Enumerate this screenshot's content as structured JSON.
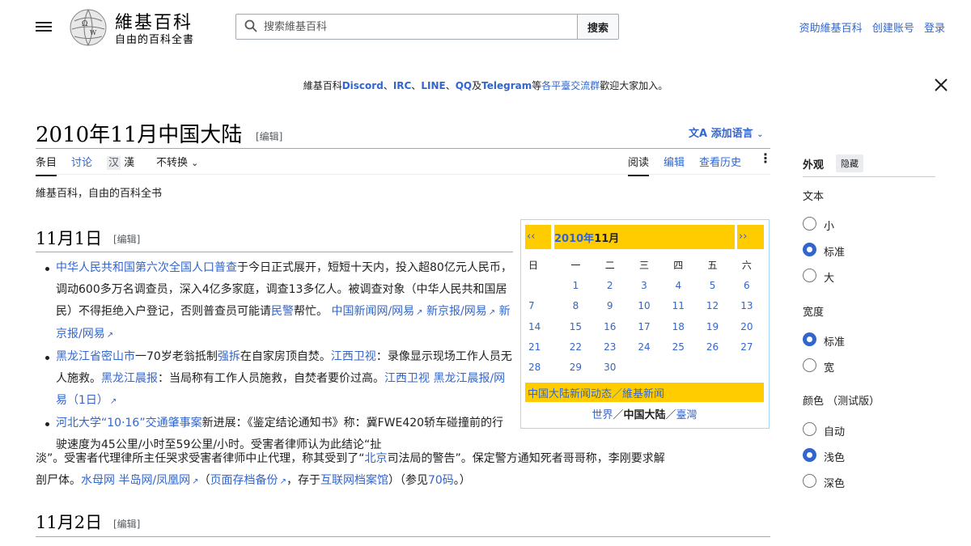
{
  "header": {
    "wordmark": "維基百科",
    "tagline": "自由的百科全書",
    "search_placeholder": "搜索維基百科",
    "search_button": "搜索",
    "links": [
      "资助維基百科",
      "创建账号",
      "登录"
    ]
  },
  "banner": {
    "prefix": "維基百科",
    "discord": "Discord",
    "sep1": "、",
    "irc": "IRC",
    "sep2": "、",
    "line": "LINE",
    "sep3": "、",
    "qq": "QQ",
    "and": "及",
    "telegram": "Telegram",
    "mid": "等",
    "groups": "各平臺交流群",
    "suffix": "歡迎大家加入。"
  },
  "page": {
    "title": "2010年11月中国大陆",
    "edit": "[编辑]",
    "lang_button": "添加语言",
    "tabs_left": [
      "条目",
      "讨论"
    ],
    "variant_sel": "汉",
    "variant_other": "漢",
    "variant_menu": "不转换",
    "tabs_right": [
      "阅读",
      "编辑",
      "查看历史"
    ],
    "from_wiki": "維基百科，自由的百科全书"
  },
  "sections": {
    "s1_title": "11月1日",
    "s2_title": "11月2日",
    "edit": "[编辑]"
  },
  "items": {
    "i1_link": "中华人民共和国第六次全国人口普查",
    "i1_text": "于今日正式展开，短短十天内，投入超80亿元人民币，调动600多万名调查员，深入4亿多家庭，调查13多亿人。被调查对象（中华人民共和国居民）不得拒绝入户登记，否则普查员可能请",
    "i1_link2": "民警",
    "i1_text2": "帮忙。",
    "i1_src": [
      "中国新闻网/网易",
      "新京报/网易",
      "新京报/网易"
    ],
    "i2_link": "黑龙江省密山市",
    "i2_text": "一70岁老翁抵制",
    "i2_link2": "强拆",
    "i2_text2": "在自家房顶自焚。",
    "i2_src1": "江西卫视",
    "i2_text3": "：录像显示现场工作人员无人施救。",
    "i2_src2": "黑龙江晨报",
    "i2_text4": "：当局称有工作人员施救，自焚者要价过高。",
    "i2_src3": "江西卫视 黑龙江晨报/网易（1日）",
    "i3_link": "河北大学“10·16”交通肇事案",
    "i3_text": "新进展：《鉴定结论通知书》称：冀FWE420轿车碰撞前的行驶速度为45公里/小时至59公里/小时。受害者律师认为此结论“扯",
    "i3_cont1": "淡”。受害者代理律所主任哭求受害者律师中止代理，称其受到了“",
    "i3_link2": "北京",
    "i3_cont2": "司法局的警告”。保定警方通知死者哥哥称，李刚要求解",
    "i3_cont3": "剖尸体。",
    "i3_src1": "水母网",
    "i3_src2": "半岛网/凤凰网",
    "i3_paren_open": "（",
    "i3_archive": "页面存档备份",
    "i3_archive_txt": "，存于",
    "i3_archive2": "互联网档案馆",
    "i3_paren_close": "）（参见",
    "i3_see": "70码",
    "i3_end": "。）"
  },
  "calendar": {
    "prev": "‹‹",
    "next": "››",
    "year": "2010年",
    "month": "11月",
    "weekdays": [
      "日",
      "一",
      "二",
      "三",
      "四",
      "五",
      "六"
    ],
    "weeks": [
      [
        "",
        "1",
        "2",
        "3",
        "4",
        "5",
        "6"
      ],
      [
        "7",
        "8",
        "9",
        "10",
        "11",
        "12",
        "13"
      ],
      [
        "14",
        "15",
        "16",
        "17",
        "18",
        "19",
        "20"
      ],
      [
        "21",
        "22",
        "23",
        "24",
        "25",
        "26",
        "27"
      ],
      [
        "28",
        "29",
        "30",
        "",
        "",
        "",
        ""
      ]
    ],
    "news": "中国大陆新闻动态／維基新闻",
    "foot_world": "世界",
    "foot_sep": "／",
    "foot_cn": "中国大陆",
    "foot_tw": "臺灣"
  },
  "appearance": {
    "title": "外观",
    "hide": "隐藏",
    "text_label": "文本",
    "text_opts": [
      "小",
      "标准",
      "大"
    ],
    "text_selected": 1,
    "width_label": "宽度",
    "width_opts": [
      "标准",
      "宽"
    ],
    "width_selected": 0,
    "color_label": "颜色 （测试版）",
    "color_opts": [
      "自动",
      "浅色",
      "深色"
    ],
    "color_selected": 1
  },
  "colors": {
    "link": "#3366cc",
    "calendar_gold": "#ffcc00",
    "calendar_border": "#a7d7f9"
  }
}
